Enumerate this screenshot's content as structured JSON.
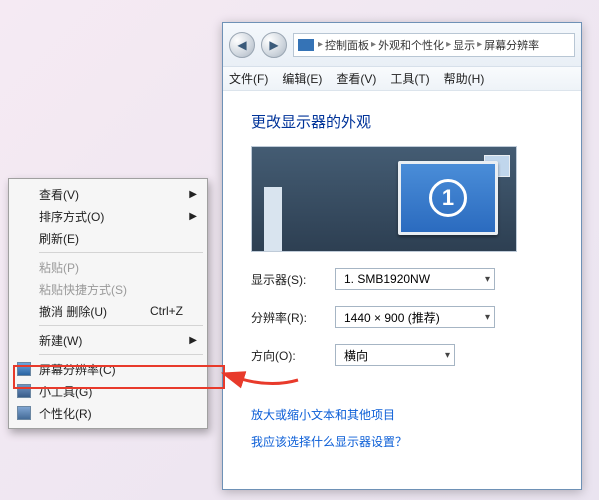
{
  "control_panel": {
    "nav": {
      "back_icon": "◀",
      "forward_icon": "▶",
      "crumbs": [
        "控制面板",
        "外观和个性化",
        "显示",
        "屏幕分辨率"
      ],
      "sep": "▸"
    },
    "menu": {
      "file": "文件(F)",
      "edit": "编辑(E)",
      "view": "查看(V)",
      "tools": "工具(T)",
      "help": "帮助(H)"
    },
    "heading": "更改显示器的外观",
    "preview": {
      "monitor_number": "1"
    },
    "rows": {
      "display_label": "显示器(S):",
      "display_value": "1. SMB1920NW",
      "resolution_label": "分辨率(R):",
      "resolution_value": "1440 × 900 (推荐)",
      "orientation_label": "方向(O):",
      "orientation_value": "横向"
    },
    "links": {
      "text_size": "放大或缩小文本和其他项目",
      "which_disp": "我应该选择什么显示器设置？"
    }
  },
  "context_menu": {
    "view": {
      "label": "查看(V)",
      "has_submenu": true
    },
    "sort": {
      "label": "排序方式(O)",
      "has_submenu": true
    },
    "refresh": {
      "label": "刷新(E)"
    },
    "paste": {
      "label": "粘贴(P)",
      "disabled": true
    },
    "paste_sc": {
      "label": "粘贴快捷方式(S)",
      "disabled": true
    },
    "undo_del": {
      "label": "撤消 删除(U)",
      "shortcut": "Ctrl+Z"
    },
    "new": {
      "label": "新建(W)",
      "has_submenu": true
    },
    "resolution": {
      "label": "屏幕分辨率(C)"
    },
    "gadgets": {
      "label": "小工具(G)"
    },
    "personal": {
      "label": "个性化(R)"
    }
  }
}
